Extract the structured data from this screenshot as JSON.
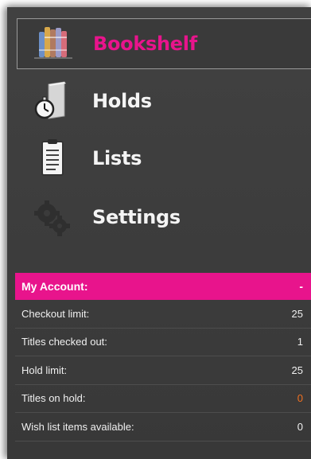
{
  "nav": {
    "items": [
      {
        "label": "Bookshelf",
        "icon": "bookshelf-icon",
        "active": true
      },
      {
        "label": "Holds",
        "icon": "holds-stopwatch-icon",
        "active": false
      },
      {
        "label": "Lists",
        "icon": "clipboard-list-icon",
        "active": false
      },
      {
        "label": "Settings",
        "icon": "gear-icon",
        "active": false
      }
    ]
  },
  "account": {
    "header_label": "My Account:",
    "header_toggle": "-",
    "rows": [
      {
        "label": "Checkout limit:",
        "value": "25"
      },
      {
        "label": "Titles checked out:",
        "value": "1"
      },
      {
        "label": "Hold limit:",
        "value": "25"
      },
      {
        "label": "Titles on hold:",
        "value": "0"
      },
      {
        "label": "Wish list items available:",
        "value": "0"
      }
    ]
  },
  "colors": {
    "accent": "#e8148c",
    "panel_bg": "#3b3b3b",
    "warning_value": "#f07020"
  }
}
